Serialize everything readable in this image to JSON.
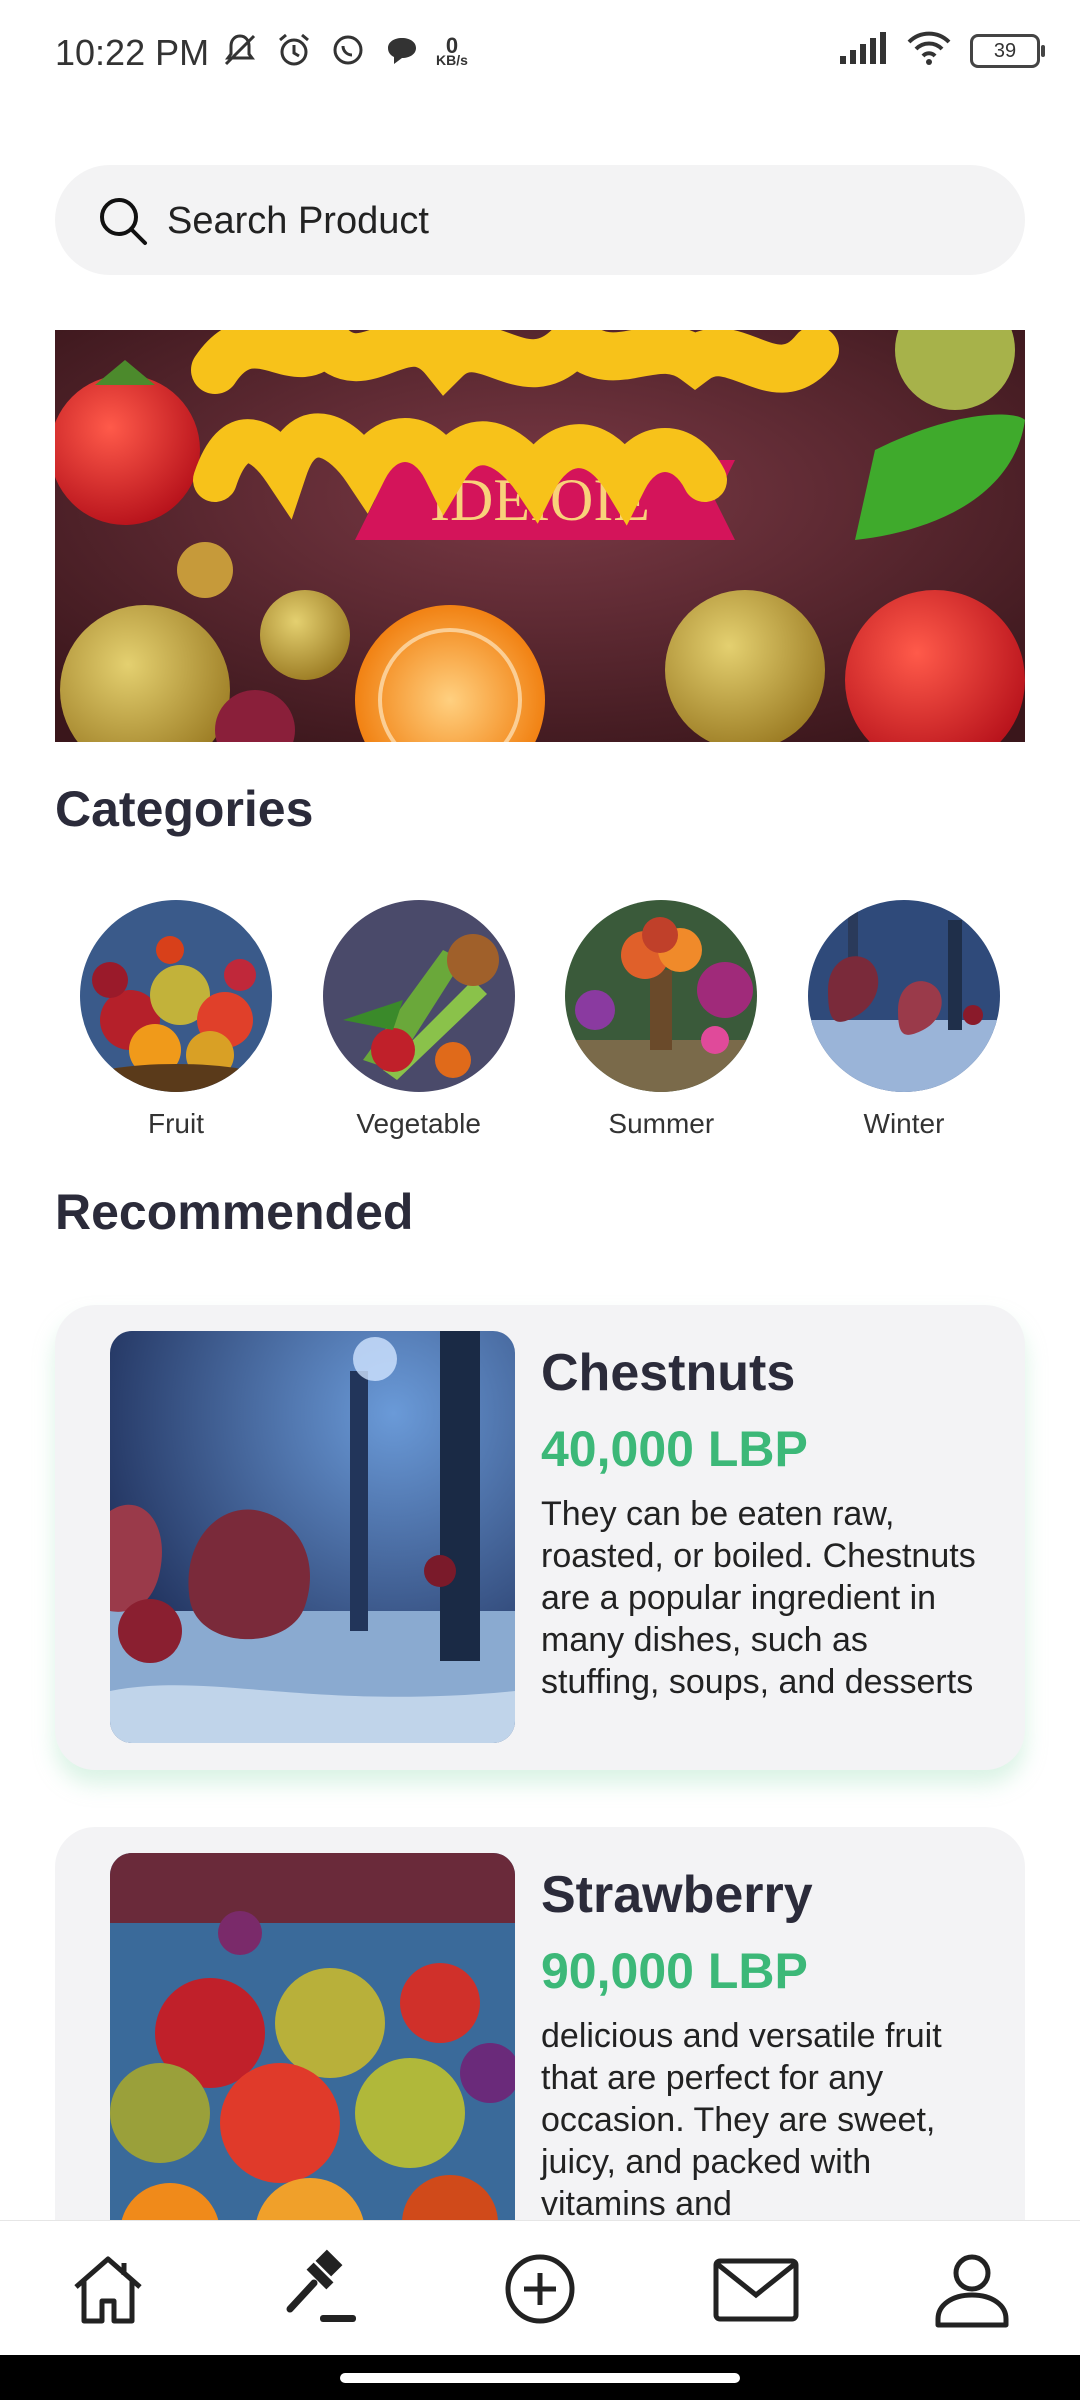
{
  "status_bar": {
    "time": "10:22 PM",
    "net_speed_value": "0",
    "net_speed_unit": "KB/s",
    "battery": "39"
  },
  "search": {
    "placeholder": "Search Product"
  },
  "categories": {
    "title": "Categories",
    "items": [
      {
        "label": "Fruit"
      },
      {
        "label": "Vegetable"
      },
      {
        "label": "Summer"
      },
      {
        "label": "Winter"
      }
    ]
  },
  "recommended": {
    "title": "Recommended",
    "products": [
      {
        "name": "Chestnuts",
        "price": "40,000 LBP",
        "description": "They can be eaten raw, roasted, or boiled. Chestnuts are a popular ingredient in many dishes, such as stuffing, soups, and desserts"
      },
      {
        "name": "Strawberry",
        "price": "90,000 LBP",
        "description": "delicious and versatile fruit that are perfect for any occasion. They are sweet, juicy, and packed with vitamins and"
      }
    ]
  },
  "bottom_nav": {
    "items": [
      {
        "icon": "home-icon"
      },
      {
        "icon": "auction-icon"
      },
      {
        "icon": "add-circle-icon"
      },
      {
        "icon": "mail-icon"
      },
      {
        "icon": "profile-icon"
      }
    ]
  },
  "colors": {
    "accent_price": "#3cb878",
    "card_bg": "#f3f3f5",
    "search_bg": "#f3f3f4"
  }
}
